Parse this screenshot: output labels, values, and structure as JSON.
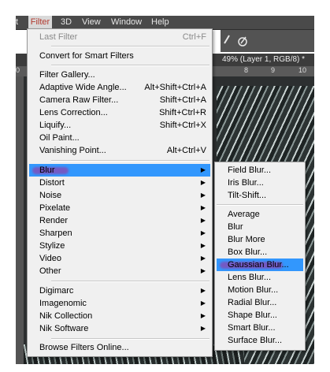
{
  "menubar": {
    "items": [
      {
        "label": "t"
      },
      {
        "label": "Filter"
      },
      {
        "label": "3D"
      },
      {
        "label": "View"
      },
      {
        "label": "Window"
      },
      {
        "label": "Help"
      }
    ]
  },
  "document": {
    "tab_title": "49% (Layer 1, RGB/8) *",
    "ruler_ticks": [
      "8",
      "9",
      "10"
    ],
    "left_ruler": [
      "0"
    ]
  },
  "filter_menu": {
    "items": [
      {
        "label": "Last Filter",
        "shortcut": "Ctrl+F",
        "disabled": true
      },
      {
        "label": "Convert for Smart Filters",
        "shortcut": ""
      },
      {
        "label": "Filter Gallery...",
        "shortcut": ""
      },
      {
        "label": "Adaptive Wide Angle...",
        "shortcut": "Alt+Shift+Ctrl+A"
      },
      {
        "label": "Camera Raw Filter...",
        "shortcut": "Shift+Ctrl+A"
      },
      {
        "label": "Lens Correction...",
        "shortcut": "Shift+Ctrl+R"
      },
      {
        "label": "Liquify...",
        "shortcut": "Shift+Ctrl+X"
      },
      {
        "label": "Oil Paint...",
        "shortcut": ""
      },
      {
        "label": "Vanishing Point...",
        "shortcut": "Alt+Ctrl+V"
      },
      {
        "label": "Blur",
        "submenu": true,
        "highlighted": true
      },
      {
        "label": "Distort",
        "submenu": true
      },
      {
        "label": "Noise",
        "submenu": true
      },
      {
        "label": "Pixelate",
        "submenu": true
      },
      {
        "label": "Render",
        "submenu": true
      },
      {
        "label": "Sharpen",
        "submenu": true
      },
      {
        "label": "Stylize",
        "submenu": true
      },
      {
        "label": "Video",
        "submenu": true
      },
      {
        "label": "Other",
        "submenu": true
      },
      {
        "label": "Digimarc",
        "submenu": true
      },
      {
        "label": "Imagenomic",
        "submenu": true
      },
      {
        "label": "Nik Collection",
        "submenu": true
      },
      {
        "label": "Nik Software",
        "submenu": true
      },
      {
        "label": "Browse Filters Online...",
        "shortcut": ""
      }
    ],
    "submenu_arrow": "▶"
  },
  "blur_submenu": {
    "items": [
      {
        "label": "Field Blur..."
      },
      {
        "label": "Iris Blur..."
      },
      {
        "label": "Tilt-Shift..."
      },
      {
        "label": "Average"
      },
      {
        "label": "Blur"
      },
      {
        "label": "Blur More"
      },
      {
        "label": "Box Blur..."
      },
      {
        "label": "Gaussian Blur...",
        "highlighted": true
      },
      {
        "label": "Lens Blur..."
      },
      {
        "label": "Motion Blur..."
      },
      {
        "label": "Radial Blur..."
      },
      {
        "label": "Shape Blur..."
      },
      {
        "label": "Smart Blur..."
      },
      {
        "label": "Surface Blur..."
      }
    ]
  },
  "toolbar": {
    "icons": [
      "brush-tool-icon",
      "pressure-pen-icon"
    ]
  },
  "colors": {
    "highlight": "#3297fd",
    "menu_bg": "#f0f0f0",
    "chrome": "#4a4a4a"
  }
}
